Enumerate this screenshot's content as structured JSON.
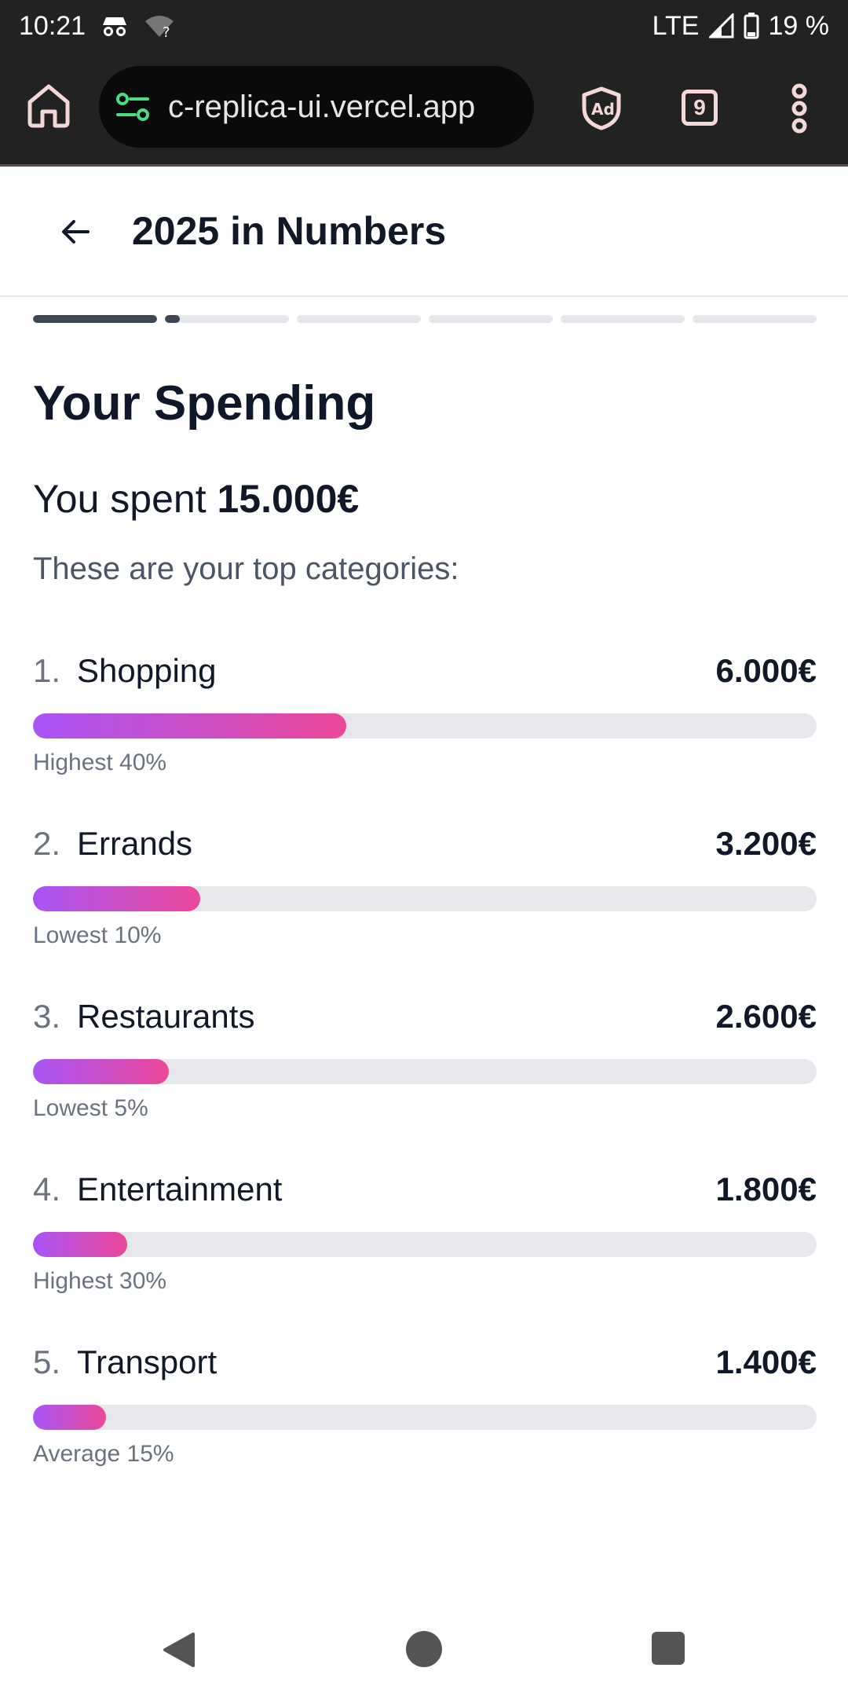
{
  "status": {
    "time": "10:21",
    "network": "LTE",
    "battery": "19 %",
    "icons": [
      "incognito-icon",
      "wifi-unknown-icon",
      "signal-icon",
      "battery-icon"
    ]
  },
  "browser": {
    "url": "c-replica-ui.vercel.app",
    "tab_count": "9",
    "icons": [
      "home-icon",
      "site-settings-icon",
      "adblock-icon",
      "tabs-icon",
      "more-vert-icon"
    ]
  },
  "header": {
    "title": "2025 in Numbers"
  },
  "story": {
    "segments": [
      {
        "progress": 1.0
      },
      {
        "progress": 0.12
      },
      {
        "progress": 0
      },
      {
        "progress": 0
      },
      {
        "progress": 0
      },
      {
        "progress": 0
      }
    ]
  },
  "main": {
    "section_title": "Your Spending",
    "spent_prefix": "You spent ",
    "spent_amount": "15.000€",
    "subtitle": "These are your top categories:",
    "categories": [
      {
        "rank": "1.",
        "name": "Shopping",
        "amount": "6.000€",
        "note": "Highest 40%",
        "fill": 0.4
      },
      {
        "rank": "2.",
        "name": "Errands",
        "amount": "3.200€",
        "note": "Lowest 10%",
        "fill": 0.213
      },
      {
        "rank": "3.",
        "name": "Restaurants",
        "amount": "2.600€",
        "note": "Lowest 5%",
        "fill": 0.173
      },
      {
        "rank": "4.",
        "name": "Entertainment",
        "amount": "1.800€",
        "note": "Highest 30%",
        "fill": 0.12
      },
      {
        "rank": "5.",
        "name": "Transport",
        "amount": "1.400€",
        "note": "Average 15%",
        "fill": 0.093
      }
    ]
  },
  "colors": {
    "bar_gradient_start": "#a855f7",
    "bar_gradient_end": "#ec4899",
    "segment_active": "#3d4854",
    "segment_inactive": "#e5e7eb"
  }
}
